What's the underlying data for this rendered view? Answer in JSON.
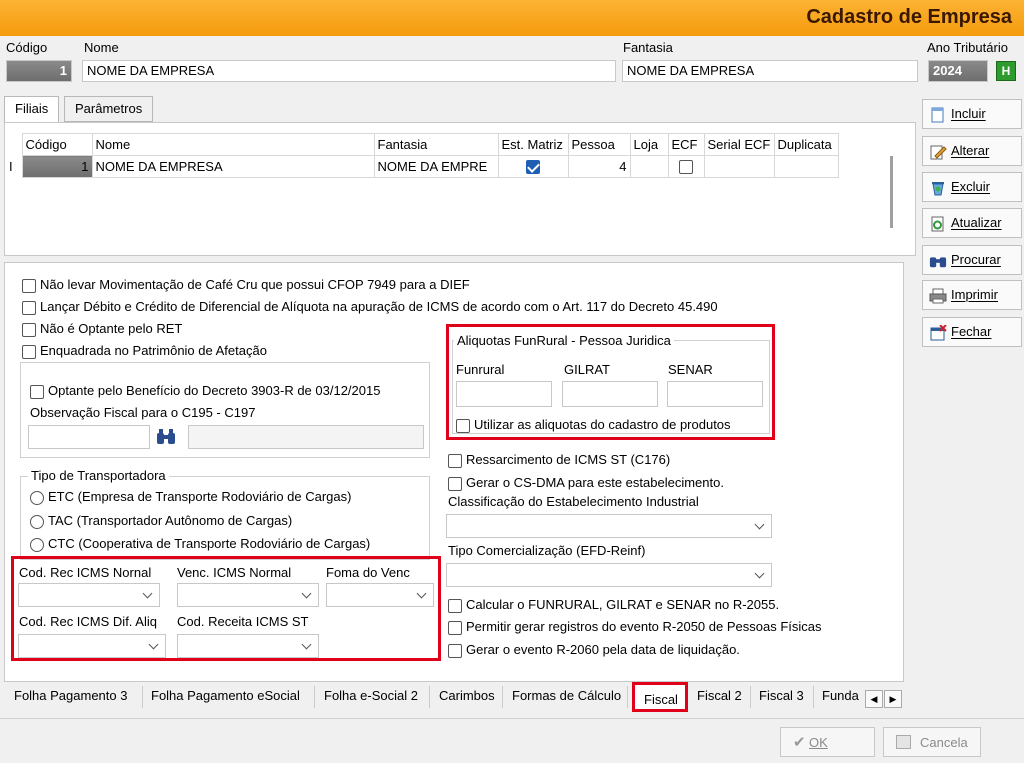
{
  "window": {
    "title": "Cadastro de Empresa"
  },
  "header": {
    "codigo_label": "Código",
    "codigo_value": "1",
    "nome_label": "Nome",
    "nome_value": "NOME DA EMPRESA",
    "fantasia_label": "Fantasia",
    "fantasia_value": "NOME DA EMPRESA",
    "ano_label": "Ano Tributário",
    "ano_value": "2024",
    "ano_button": "H"
  },
  "tabs": [
    {
      "label": "Filiais"
    },
    {
      "label": "Parâmetros"
    }
  ],
  "grid": {
    "columns": [
      "Código",
      "Nome",
      "Fantasia",
      "Est. Matriz",
      "Pessoa",
      "Loja",
      "ECF",
      "Serial ECF",
      "Duplicata"
    ],
    "row_marker": "I",
    "rows": [
      {
        "codigo": "1",
        "nome": "NOME DA EMPRESA",
        "fantasia": "NOME DA EMPRE",
        "est_matriz": true,
        "pessoa": "4",
        "loja": "",
        "ecf": false,
        "serial_ecf": "",
        "duplicata": ""
      }
    ]
  },
  "options": {
    "cafe": "Não levar Movimentação de Café Cru que possui CFOP 7949 para a DIEF",
    "difal": "Lançar Débito e Crédito de Diferencial de Alíquota na apuração de ICMS de acordo com o Art. 117 do Decreto 45.490",
    "ret": "Não é Optante pelo RET",
    "afetacao": "Enquadrada no Patrimônio de Afetação",
    "decreto": "Optante pelo Benefício do Decreto 3903-R de 03/12/2015",
    "obs_label": "Observação Fiscal para o C195 - C197"
  },
  "funrural": {
    "title": "Aliquotas FunRural - Pessoa Juridica",
    "funrural_label": "Funrural",
    "gilrat_label": "GILRAT",
    "senar_label": "SENAR",
    "utilizar": "Utilizar as aliquotas do cadastro de produtos"
  },
  "transportadora": {
    "title": "Tipo de Transportadora",
    "options": [
      "ETC (Empresa de Transporte Rodoviário de Cargas)",
      "TAC (Transportador Autônomo de Cargas)",
      "CTC (Cooperativa de Transporte Rodoviário de Cargas)"
    ]
  },
  "right_opts": {
    "ressarcimento": "Ressarcimento de ICMS ST (C176)",
    "csdma": "Gerar o CS-DMA para este estabelecimento.",
    "classif_label": "Classificação do Estabelecimento Industrial",
    "tipo_com_label": "Tipo Comercialização (EFD-Reinf)",
    "calcular": "Calcular o FUNRURAL, GILRAT e SENAR no R-2055.",
    "permitir": "Permitir gerar registros do evento R-2050 de Pessoas Físicas",
    "gerar": "Gerar o evento R-2060 pela data de liquidação."
  },
  "icms": {
    "rec_normal": "Cod. Rec ICMS Nornal",
    "venc_normal": "Venc. ICMS Normal",
    "forma_venc": "Foma do Venc",
    "rec_dif": "Cod. Rec ICMS Dif. Aliq",
    "receita_st": "Cod. Receita ICMS ST"
  },
  "bottom_tabs": [
    "Folha Pagamento 3",
    "Folha Pagamento eSocial",
    "Folha e-Social 2",
    "Carimbos",
    "Formas de Cálculo",
    "Fiscal",
    "Fiscal 2",
    "Fiscal 3",
    "Funda"
  ],
  "side_buttons": [
    "Incluir",
    "Alterar",
    "Excluir",
    "Atualizar",
    "Procurar",
    "Imprimir",
    "Fechar"
  ],
  "footer": {
    "ok": "OK",
    "cancel": "Cancela"
  },
  "colors": {
    "accent": "#f59b0c",
    "highlight": "#e0001a",
    "check": "#1e5fb3"
  }
}
